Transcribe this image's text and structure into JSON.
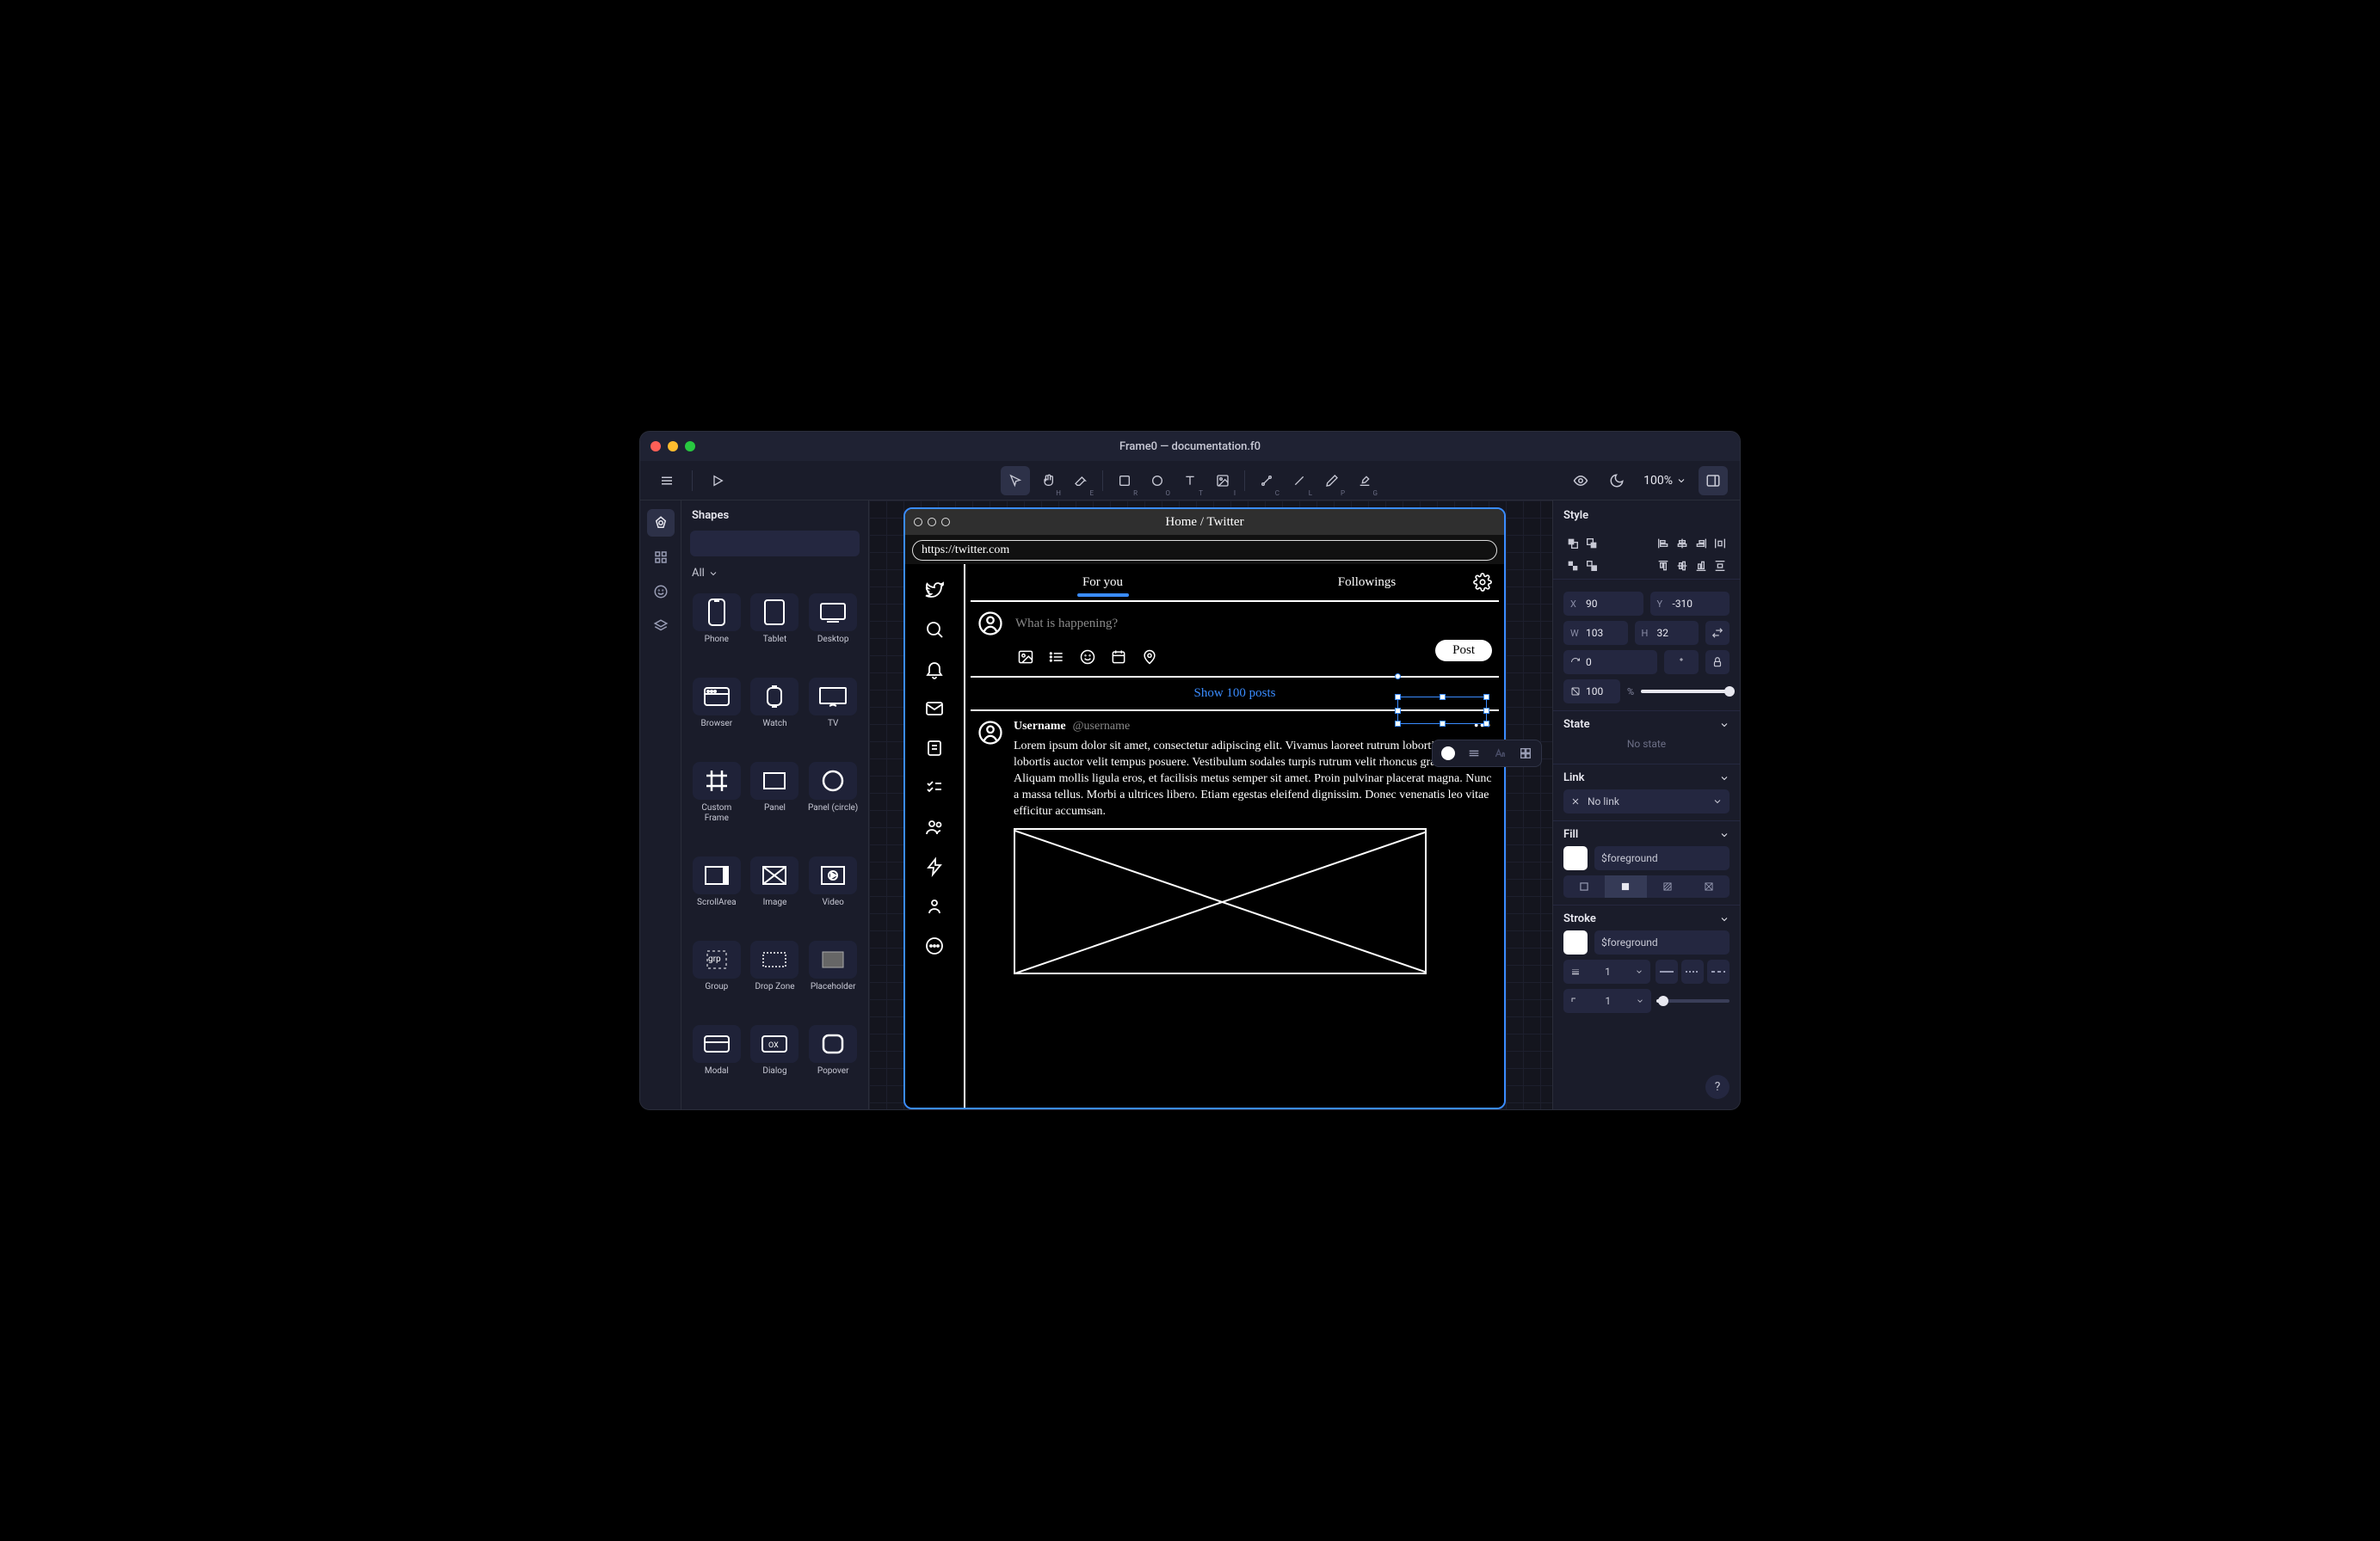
{
  "window_title": "Frame0 — documentation.f0",
  "zoom": "100%",
  "left_panel": {
    "title": "Shapes",
    "search_placeholder": "",
    "filter": "All",
    "shapes": [
      {
        "label": "Phone"
      },
      {
        "label": "Tablet"
      },
      {
        "label": "Desktop"
      },
      {
        "label": "Browser"
      },
      {
        "label": "Watch"
      },
      {
        "label": "TV"
      },
      {
        "label": "Custom Frame"
      },
      {
        "label": "Panel"
      },
      {
        "label": "Panel (circle)"
      },
      {
        "label": "ScrollArea"
      },
      {
        "label": "Image"
      },
      {
        "label": "Video"
      },
      {
        "label": "Group"
      },
      {
        "label": "Drop Zone"
      },
      {
        "label": "Placeholder"
      },
      {
        "label": "Modal"
      },
      {
        "label": "Dialog"
      },
      {
        "label": "Popover"
      }
    ]
  },
  "canvas": {
    "browser_title": "Home / Twitter",
    "url": "https://twitter.com",
    "tabs": {
      "for_you": "For you",
      "followings": "Followings"
    },
    "compose_placeholder": "What is happening?",
    "post_button": "Post",
    "show_posts": "Show 100 posts",
    "post": {
      "username": "Username",
      "handle": "@username",
      "body": "Lorem ipsum dolor sit amet, consectetur adipiscing elit. Vivamus laoreet rutrum lobortis. Etiam lobortis auctor velit tempus posuere. Vestibulum sodales turpis rutrum velit rhoncus gravida. Aliquam mollis ligula eros, et facilisis metus semper sit amet. Proin pulvinar placerat magna. Nunc a massa tellus. Morbi a ultrices libero. Etiam egestas eleifend dignissim. Donec venenatis leo vitae efficitur accumsan."
    }
  },
  "right_panel": {
    "title": "Style",
    "x": "90",
    "y": "-310",
    "w": "103",
    "h": "32",
    "rotation": "0",
    "rotation_unit": "°",
    "opacity": "100",
    "opacity_unit": "%",
    "state_title": "State",
    "state_value": "No state",
    "link_title": "Link",
    "link_value": "No link",
    "fill_title": "Fill",
    "fill_value": "$foreground",
    "stroke_title": "Stroke",
    "stroke_value": "$foreground",
    "stroke_width": "1",
    "stroke_join": "1"
  },
  "help": "?"
}
